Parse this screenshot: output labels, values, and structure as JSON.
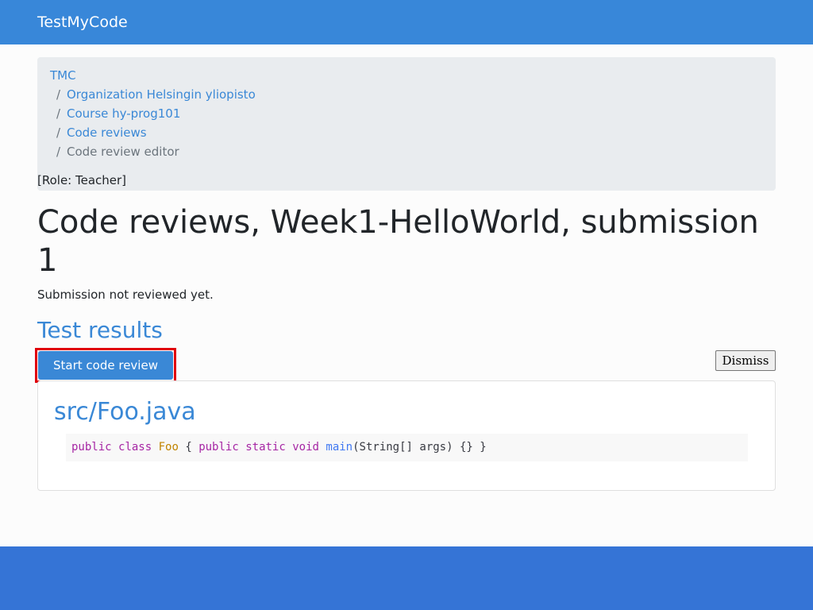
{
  "navbar": {
    "brand": "TestMyCode"
  },
  "breadcrumb": {
    "separator": "/",
    "items": [
      {
        "label": "TMC"
      },
      {
        "label": "Organization Helsingin yliopisto"
      },
      {
        "label": "Course hy-prog101"
      },
      {
        "label": "Code reviews"
      },
      {
        "label": "Code review editor"
      }
    ]
  },
  "role": "[Role: Teacher]",
  "page_title": "Code reviews, Week1-HelloWorld, submission 1",
  "review_status": "Submission not reviewed yet.",
  "test_results": {
    "heading": "Test results"
  },
  "actions": {
    "start_review_label": "Start code review",
    "dismiss_label": "Dismiss"
  },
  "file": {
    "name": "src/Foo.java",
    "code_tokens": [
      {
        "text": "public",
        "kind": "keyword"
      },
      {
        "text": " ",
        "kind": "plain"
      },
      {
        "text": "class",
        "kind": "keyword"
      },
      {
        "text": " ",
        "kind": "plain"
      },
      {
        "text": "Foo",
        "kind": "class"
      },
      {
        "text": " { ",
        "kind": "plain"
      },
      {
        "text": "public",
        "kind": "keyword"
      },
      {
        "text": " ",
        "kind": "plain"
      },
      {
        "text": "static",
        "kind": "keyword"
      },
      {
        "text": " ",
        "kind": "plain"
      },
      {
        "text": "void",
        "kind": "keyword"
      },
      {
        "text": " ",
        "kind": "plain"
      },
      {
        "text": "main",
        "kind": "function"
      },
      {
        "text": "(String[] args) {} }",
        "kind": "plain"
      }
    ]
  },
  "colors": {
    "navbar": "#3887d9",
    "footer": "#3574d6",
    "link": "#3a88d6",
    "highlight_border": "#e0000b"
  }
}
